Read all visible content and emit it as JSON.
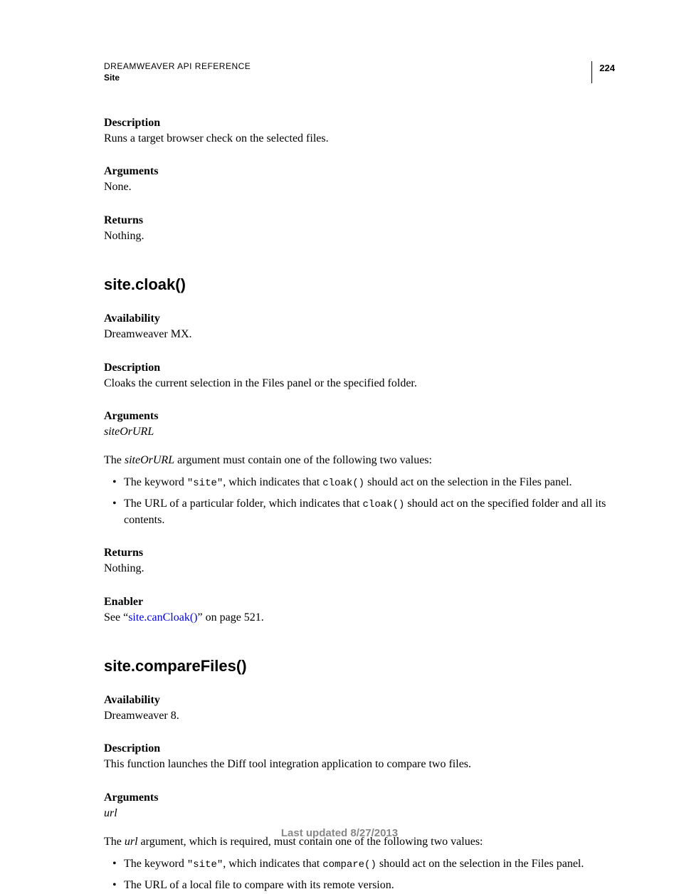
{
  "header": {
    "doc_title": "DREAMWEAVER API REFERENCE",
    "section": "Site",
    "page_number": "224"
  },
  "intro": {
    "desc_label": "Description",
    "desc_text": "Runs a target browser check on the selected files.",
    "args_label": "Arguments",
    "args_text": "None.",
    "returns_label": "Returns",
    "returns_text": "Nothing."
  },
  "cloak": {
    "title": "site.cloak()",
    "avail_label": "Availability",
    "avail_text": "Dreamweaver MX.",
    "desc_label": "Description",
    "desc_text": "Cloaks the current selection in the Files panel or the specified folder.",
    "args_label": "Arguments",
    "args_param": "siteOrURL",
    "args_intro_pre": "The ",
    "args_intro_em": "siteOrURL",
    "args_intro_post": " argument must contain one of the following two values:",
    "b1_a": "The keyword ",
    "b1_code1": "\"site\"",
    "b1_b": ", which indicates that ",
    "b1_code2": "cloak()",
    "b1_c": " should act on the selection in the Files panel.",
    "b2_a": "The URL of a particular folder, which indicates that ",
    "b2_code": "cloak()",
    "b2_b": " should act on the specified folder and all its contents.",
    "returns_label": "Returns",
    "returns_text": "Nothing.",
    "enabler_label": "Enabler",
    "enabler_pre": "See “",
    "enabler_link": "site.canCloak()",
    "enabler_post": "” on page 521."
  },
  "compare": {
    "title": "site.compareFiles()",
    "avail_label": "Availability",
    "avail_text": "Dreamweaver 8.",
    "desc_label": "Description",
    "desc_text": "This function launches the Diff tool integration application to compare two files.",
    "args_label": "Arguments",
    "args_param": "url",
    "args_intro_pre": "The ",
    "args_intro_em": "url",
    "args_intro_post": " argument, which is required, must contain one of the following two values:",
    "b1_a": "The keyword ",
    "b1_code1": "\"site\"",
    "b1_b": ", which indicates that ",
    "b1_code2": "compare()",
    "b1_c": " should act on the selection in the Files panel.",
    "b2": "The URL of a local file to compare with its remote version."
  },
  "footer": "Last updated 8/27/2013"
}
